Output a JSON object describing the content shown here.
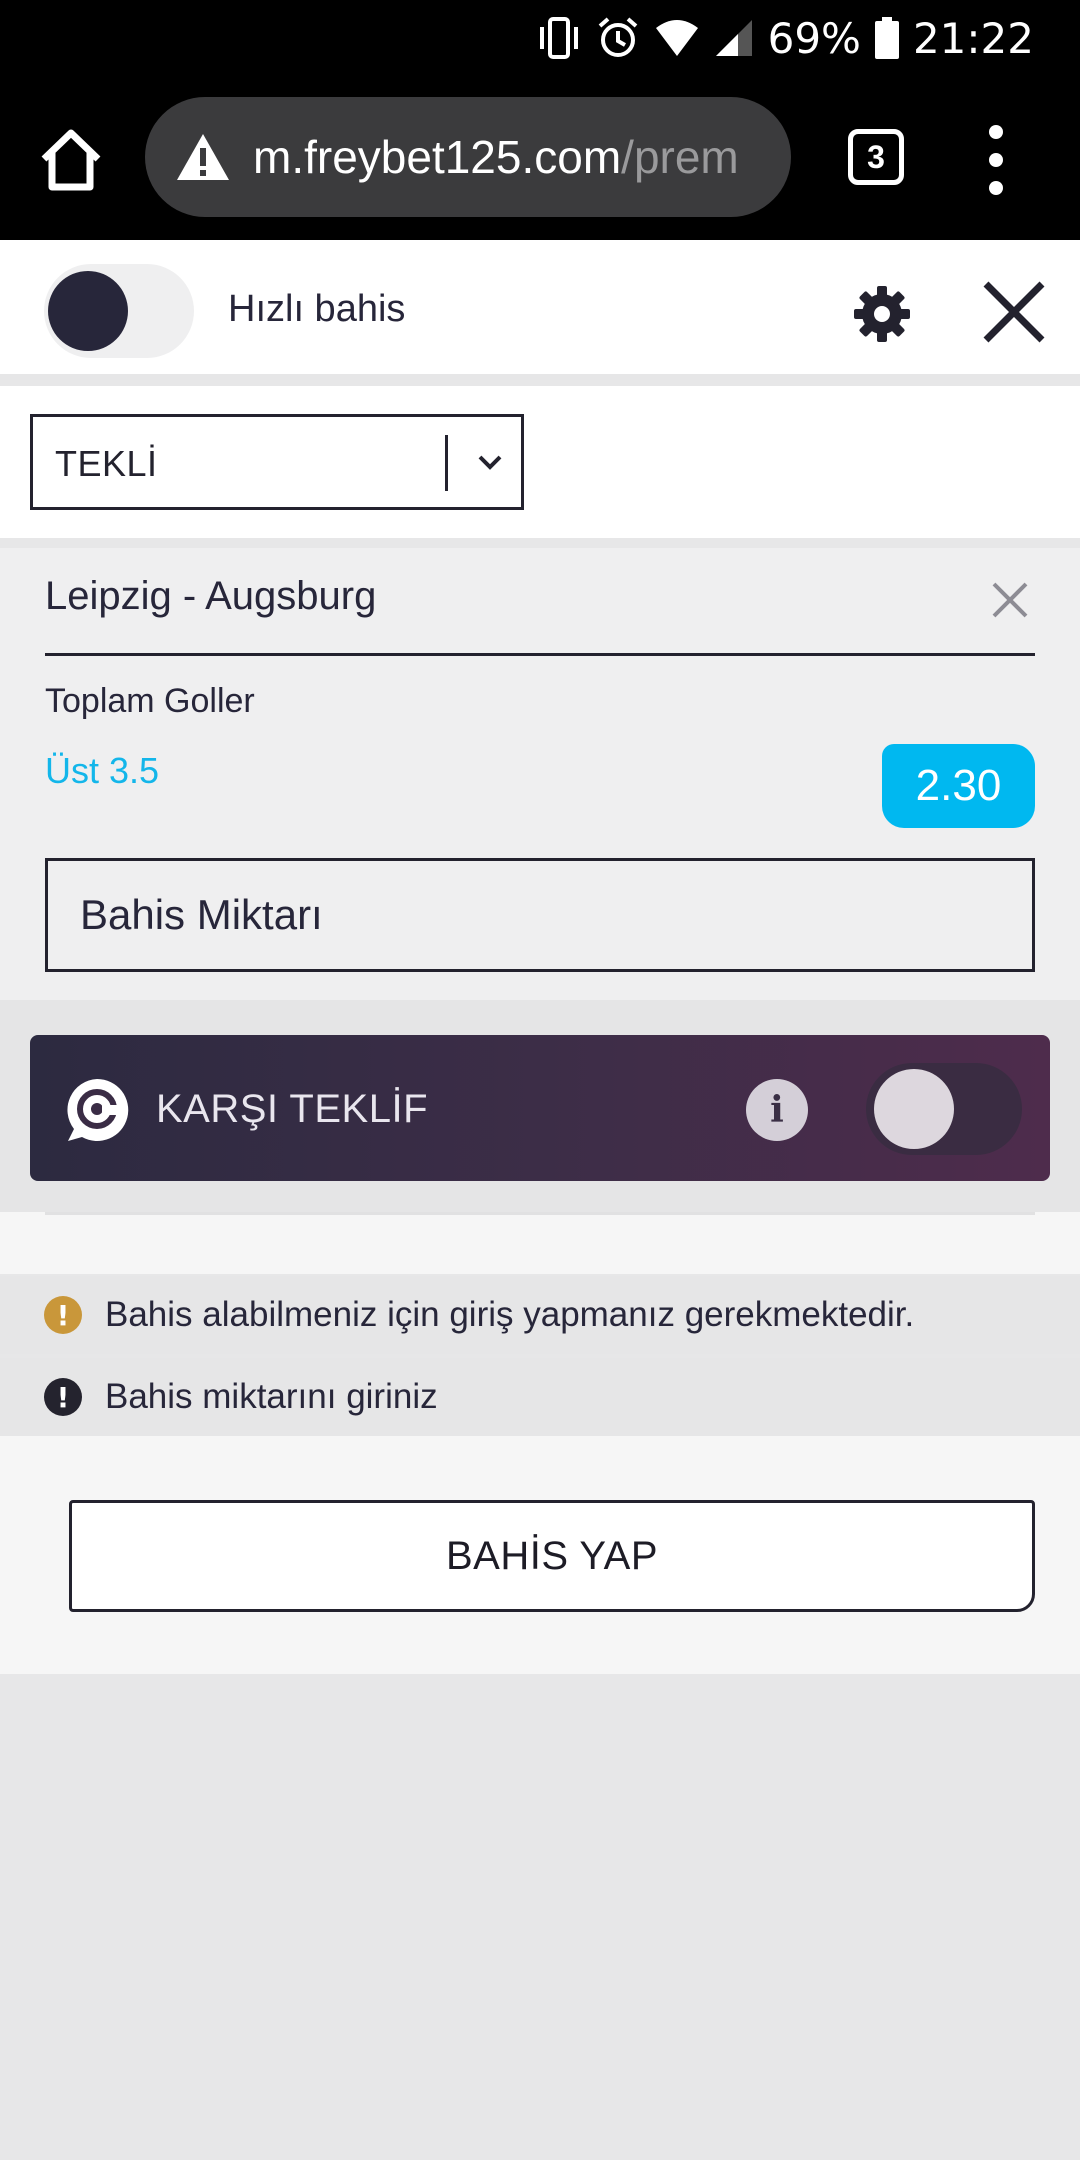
{
  "status_bar": {
    "battery": "69%",
    "time": "21:22"
  },
  "browser": {
    "url_domain": "m.freybet125.com",
    "url_path": "/prem",
    "tab_count": "3"
  },
  "header": {
    "quick_bet_label": "Hızlı bahis"
  },
  "bet_type": {
    "selected": "TEKLİ"
  },
  "bet": {
    "match": "Leipzig - Augsburg",
    "market": "Toplam Goller",
    "selection": "Üst 3.5",
    "odds": "2.30",
    "stake_placeholder": "Bahis Miktarı"
  },
  "counter_offer": {
    "label": "KARŞI TEKLİF",
    "info": "i"
  },
  "messages": {
    "login_required": "Bahis alabilmeniz için giriş yapmanız gerekmektedir.",
    "enter_stake": "Bahis miktarını giriniz"
  },
  "actions": {
    "place_bet": "BAHİS YAP"
  },
  "colors": {
    "accent": "#00b8f0",
    "dark": "#23222e",
    "counter_bg": "#3c2d47",
    "warning": "#c9973a"
  }
}
